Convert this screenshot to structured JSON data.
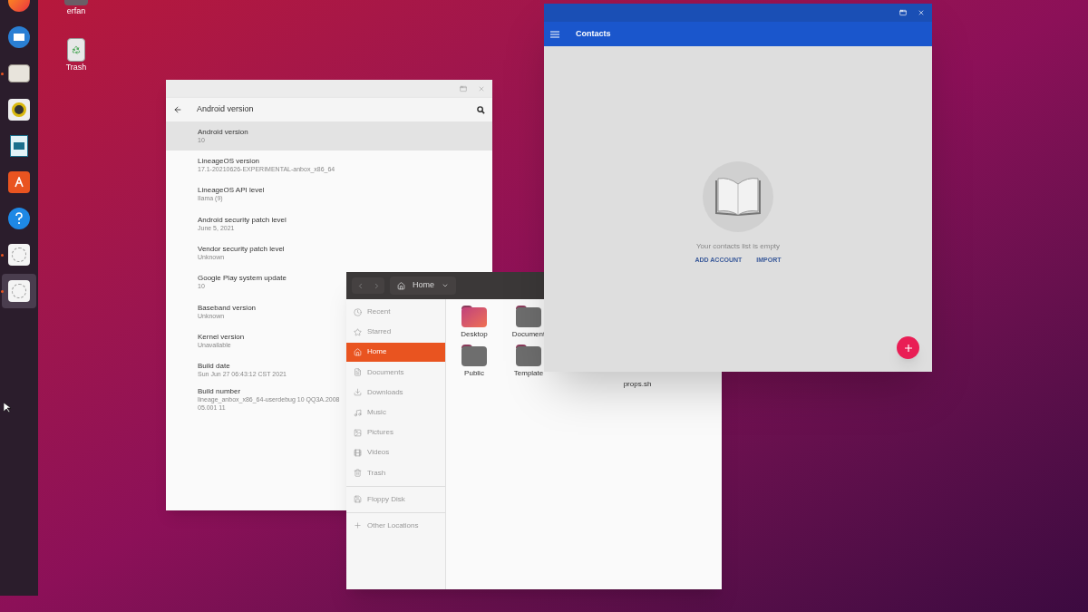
{
  "dock": [
    {
      "kind": "browser",
      "running": false,
      "selected": false
    },
    {
      "kind": "mail",
      "running": false,
      "selected": false
    },
    {
      "kind": "files",
      "running": true,
      "selected": false
    },
    {
      "kind": "music",
      "running": false,
      "selected": false
    },
    {
      "kind": "writer",
      "running": false,
      "selected": false
    },
    {
      "kind": "store",
      "running": false,
      "selected": false
    },
    {
      "kind": "help",
      "running": false,
      "selected": false
    },
    {
      "kind": "app",
      "running": true,
      "selected": false
    },
    {
      "kind": "app",
      "running": true,
      "selected": true
    }
  ],
  "desktop_icons": [
    {
      "kind": "home",
      "label": "erfan"
    },
    {
      "kind": "trash",
      "label": "Trash"
    }
  ],
  "settings_window": {
    "title": "Android version",
    "items": [
      {
        "title": "Android version",
        "value": "10",
        "selected": true
      },
      {
        "title": "LineageOS version",
        "value": "17.1-20210626-EXPERIMENTAL-anbox_x86_64",
        "selected": false
      },
      {
        "title": "LineageOS API level",
        "value": "Ilama (9)",
        "selected": false
      },
      {
        "title": "Android security patch level",
        "value": "June 5, 2021",
        "selected": false
      },
      {
        "title": "Vendor security patch level",
        "value": "Unknown",
        "selected": false
      },
      {
        "title": "Google Play system update",
        "value": "10",
        "selected": false
      },
      {
        "title": "Baseband version",
        "value": "Unknown",
        "selected": false
      },
      {
        "title": "Kernel version",
        "value": "Unavailable",
        "selected": false
      },
      {
        "title": "Build date",
        "value": "Sun Jun 27 06:43:12 CST 2021",
        "selected": false
      },
      {
        "title": "Build number",
        "value": "lineage_anbox_x86_64-userdebug 10 QQ3A.200805.001 11",
        "selected": false
      }
    ]
  },
  "file_manager": {
    "location": "Home",
    "sidebar": [
      {
        "kind": "recent",
        "label": "Recent",
        "selected": false
      },
      {
        "kind": "starred",
        "label": "Starred",
        "selected": false
      },
      {
        "kind": "home",
        "label": "Home",
        "selected": true
      },
      {
        "kind": "documents",
        "label": "Documents",
        "selected": false
      },
      {
        "kind": "downloads",
        "label": "Downloads",
        "selected": false
      },
      {
        "kind": "music",
        "label": "Music",
        "selected": false
      },
      {
        "kind": "pictures",
        "label": "Pictures",
        "selected": false
      },
      {
        "kind": "videos",
        "label": "Videos",
        "selected": false
      },
      {
        "kind": "trash",
        "label": "Trash",
        "selected": false
      },
      {
        "kind": "drive",
        "label": "Floppy Disk",
        "selected": false
      },
      {
        "kind": "other",
        "label": "Other Locations",
        "selected": false
      }
    ],
    "files": [
      {
        "kind": "desktop",
        "label": "Desktop"
      },
      {
        "kind": "documents",
        "label": "Document"
      },
      {
        "kind": "public",
        "label": "Public"
      },
      {
        "kind": "templates",
        "label": "Template"
      }
    ],
    "hidden_file_label": "props.sh"
  },
  "contacts_window": {
    "title": "Contacts",
    "empty_message": "Your contacts list is empty",
    "actions": [
      "ADD ACCOUNT",
      "IMPORT"
    ]
  }
}
